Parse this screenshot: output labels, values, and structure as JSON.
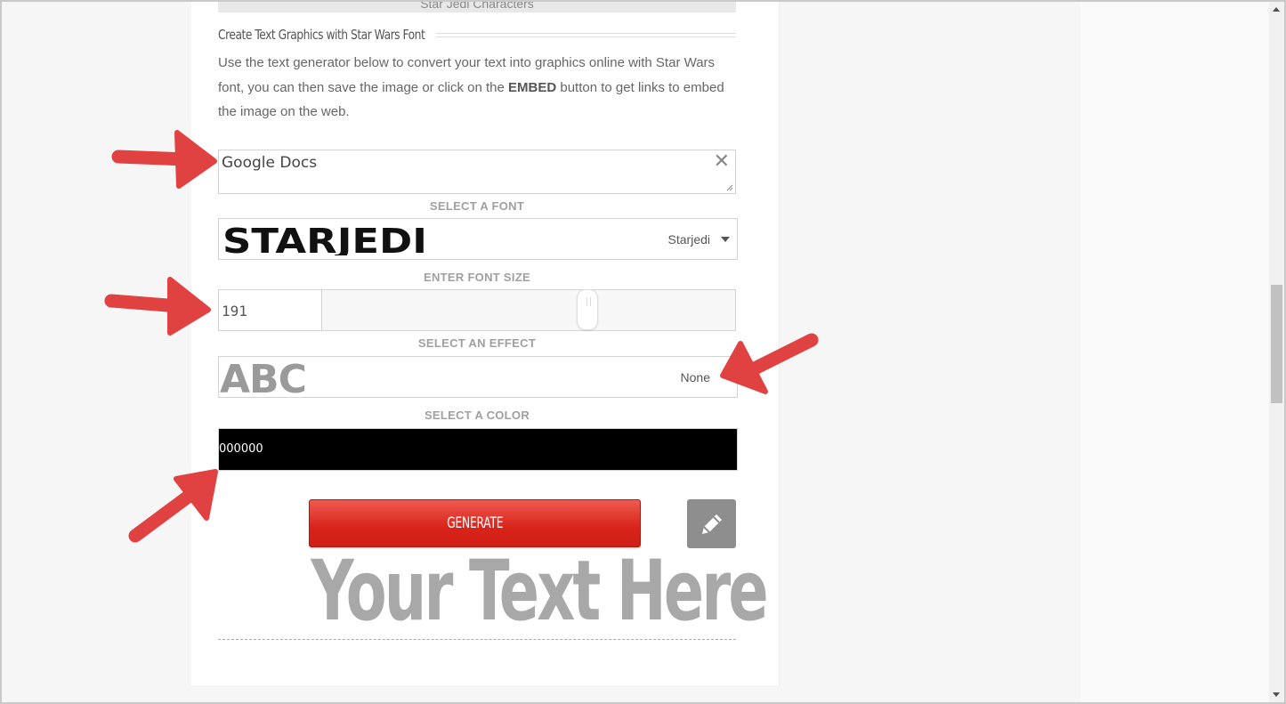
{
  "previous_section": {
    "label": "Star Jedi Characters"
  },
  "heading": {
    "title": "Create Text Graphics with Star Wars Font"
  },
  "intro": {
    "before": "Use the text generator below to convert your text into graphics online with Star Wars font, you can then save the image or click on the ",
    "emphasis": "EMBED",
    "after": " button to get links to embed the image on the web."
  },
  "text_input": {
    "value": "Google Docs",
    "clear_icon": "close-icon"
  },
  "font": {
    "label": "SELECT A FONT",
    "preview_text": "STARJEDI",
    "selected": "Starjedi",
    "icon": "chevron-down-icon"
  },
  "font_size": {
    "label": "ENTER FONT SIZE",
    "value": "191"
  },
  "effect": {
    "label": "SELECT AN EFFECT",
    "preview_text": "ABC",
    "selected": "None"
  },
  "color": {
    "label": "SELECT A COLOR",
    "value": "000000",
    "swatch": "#000000"
  },
  "actions": {
    "generate_label": "GENERATE",
    "edit_icon": "pencil-icon"
  },
  "preview": {
    "text": "Your Text Here"
  },
  "colors": {
    "accent_red": "#d8231a",
    "annotation_arrow": "#e04141",
    "label_gray": "#a0a0a0"
  }
}
